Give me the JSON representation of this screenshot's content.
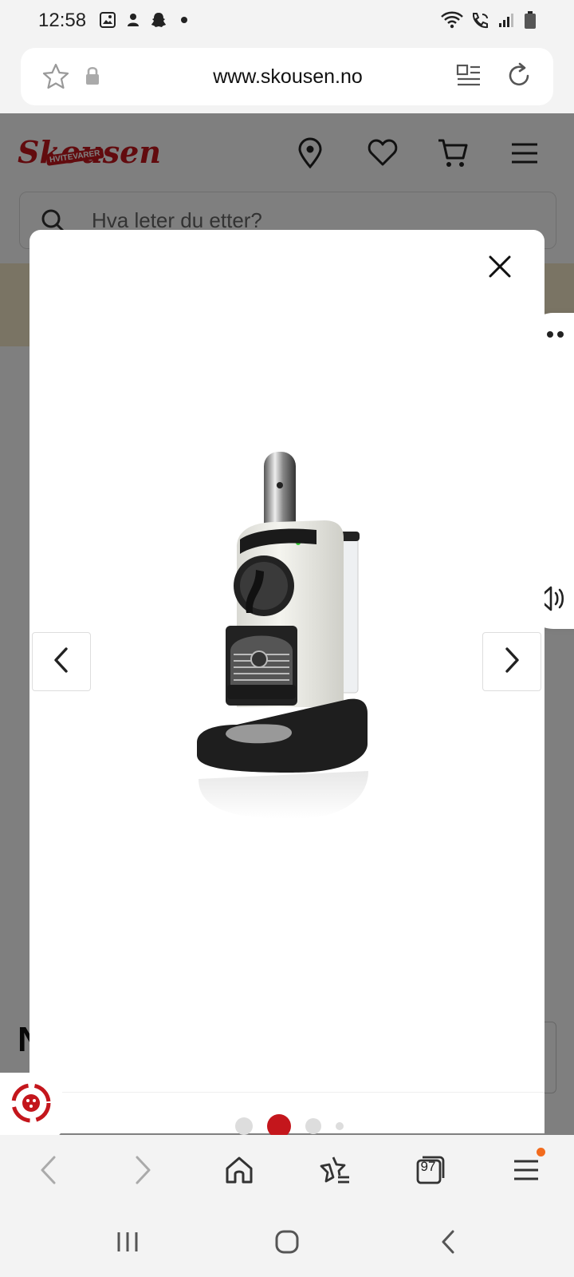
{
  "status_bar": {
    "time": "12:58",
    "left_icons": [
      "gallery-icon",
      "person-alert-icon",
      "snapchat-icon",
      "dot-icon"
    ],
    "right_icons": [
      "wifi-icon",
      "wifi-call-icon",
      "signal-icon",
      "battery-icon"
    ]
  },
  "browser": {
    "url": "www.skousen.no"
  },
  "site": {
    "logo_small_text": "HVITEVARER",
    "logo_text": "Skousen",
    "search_placeholder": "Hva leter du etter?",
    "brand_color": "#c4161c",
    "heading_partial": "N"
  },
  "gallery": {
    "total_images": 4,
    "active_index": 2,
    "product_image_alt": "Nespresso Citiz coffee machine, white"
  },
  "toolbar": {
    "tabs_count": "97"
  }
}
